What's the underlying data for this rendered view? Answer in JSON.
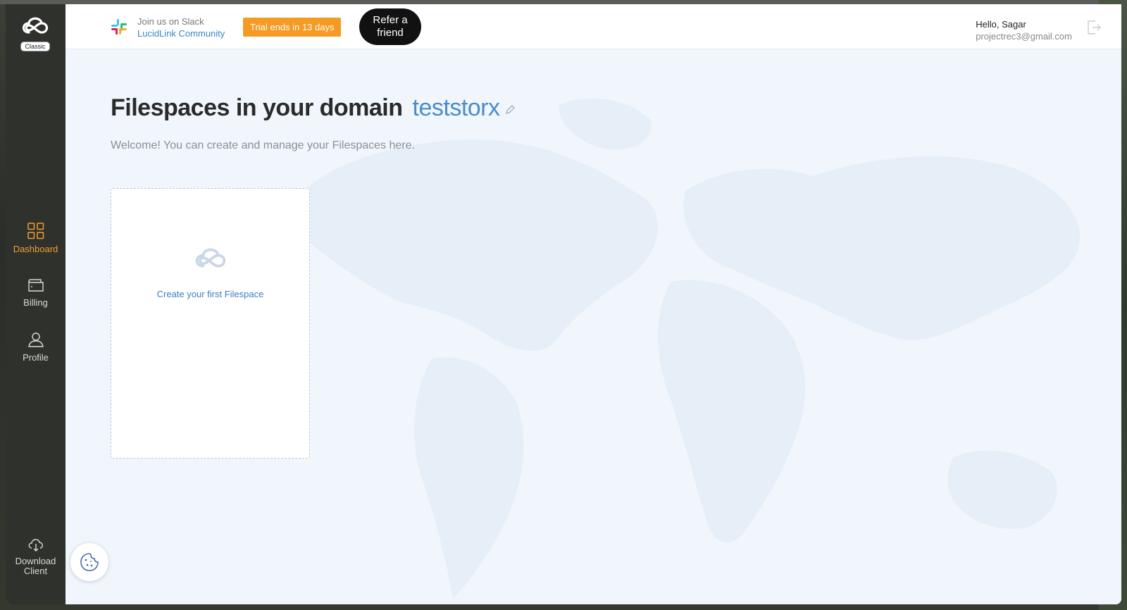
{
  "app": {
    "badge": "Classic"
  },
  "sidebar": {
    "items": [
      {
        "label": "Dashboard",
        "icon": "grid-icon",
        "active": true
      },
      {
        "label": "Billing",
        "icon": "wallet-icon"
      },
      {
        "label": "Profile",
        "icon": "user-icon"
      }
    ],
    "download": {
      "label_line1": "Download",
      "label_line2": "Client",
      "icon": "cloud-download-icon"
    }
  },
  "header": {
    "slack_line1": "Join us on Slack",
    "slack_line2": "LucidLink Community",
    "trial": "Trial ends in 13 days",
    "refer_line1": "Refer a",
    "refer_line2": "friend",
    "hello": "Hello, Sagar",
    "email": "projectrec3@gmail.com"
  },
  "main": {
    "title": "Filespaces in your domain",
    "domain": "teststorx",
    "welcome": "Welcome! You can create and manage your Filespaces here.",
    "create_label": "Create your first Filespace"
  },
  "colors": {
    "accent": "#f59a23",
    "link": "#4a8ccc",
    "sidebar": "#2f312d",
    "background": "#f1f6fc"
  }
}
